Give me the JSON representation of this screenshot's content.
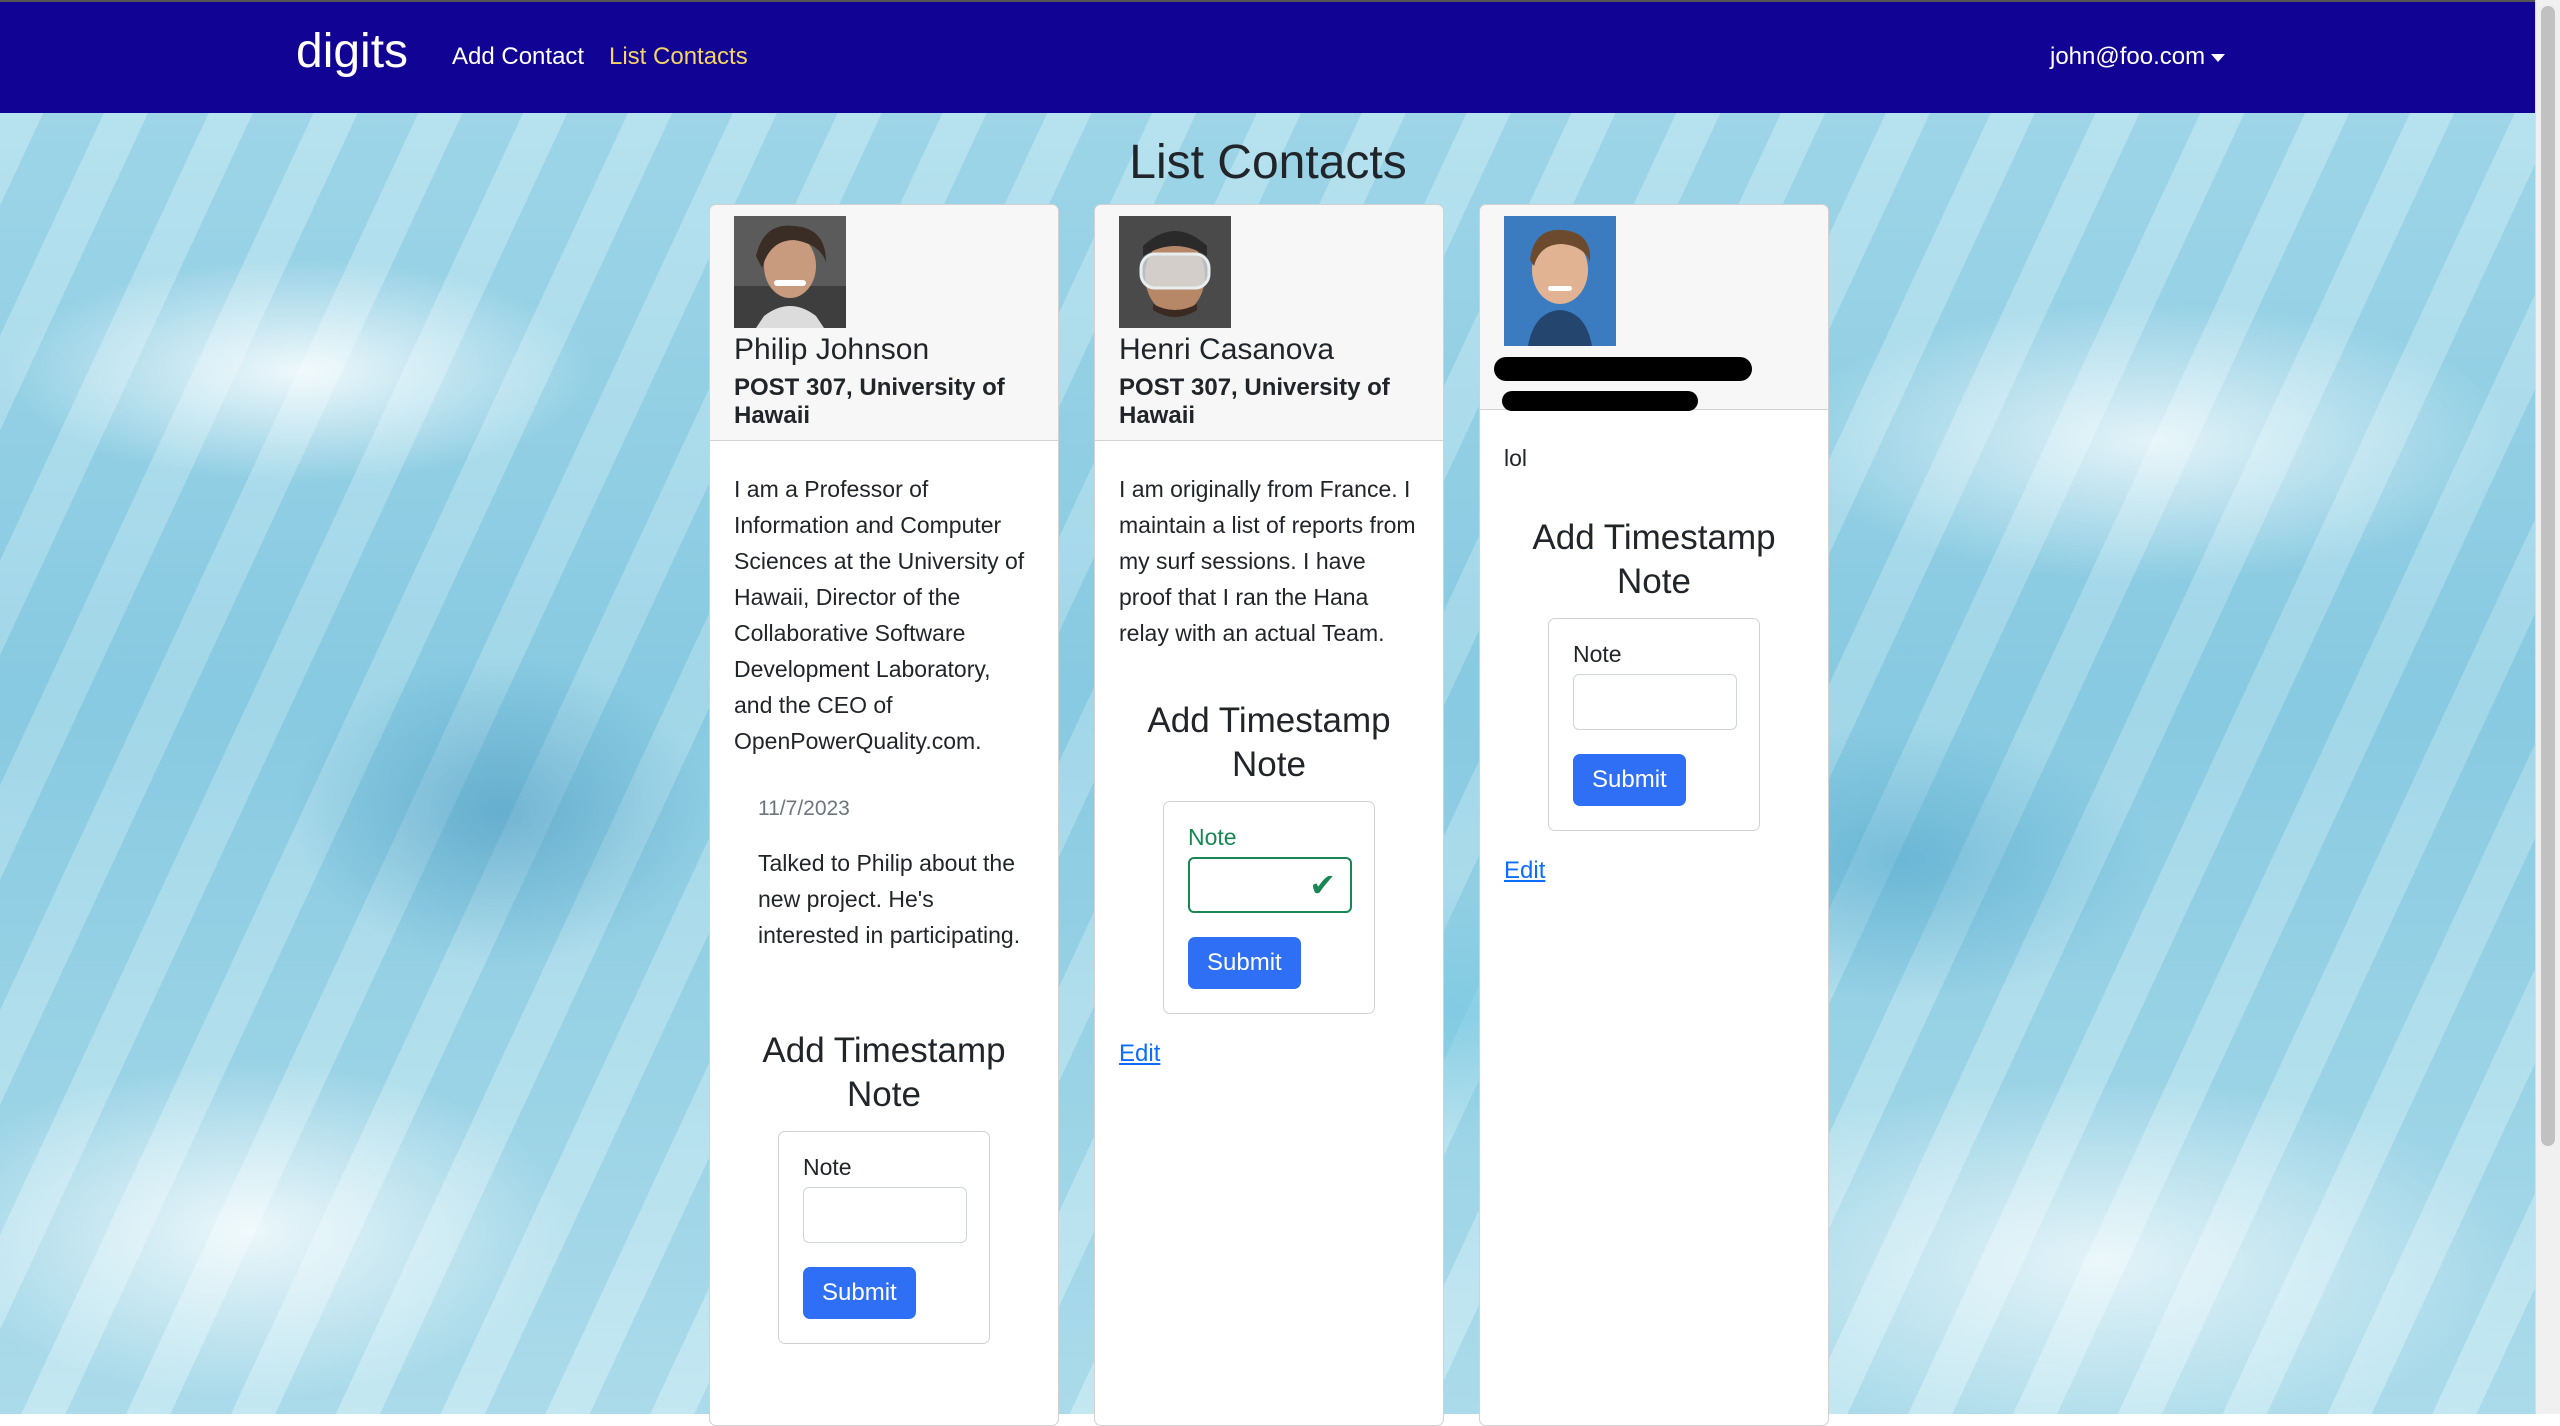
{
  "nav": {
    "brand": "digits",
    "links": [
      "Add Contact",
      "List Contacts"
    ],
    "user": "john@foo.com"
  },
  "page": {
    "title": "List Contacts"
  },
  "contacts": [
    {
      "name": "Philip Johnson",
      "address": "POST 307, University of Hawaii",
      "description": "I am a Professor of Information and Computer Sciences at the University of Hawaii, Director of the Collaborative Software Development Laboratory, and the CEO of OpenPowerQuality.com.",
      "notes": [
        {
          "date": "11/7/2023",
          "text": "Talked to Philip about the new project. He's interested in participating."
        }
      ]
    },
    {
      "name": "Henri Casanova",
      "address": "POST 307, University of Hawaii",
      "description": "I am originally from France. I maintain a list of reports from my surf sessions. I have proof that I ran the Hana relay with an actual Team.",
      "notes": []
    },
    {
      "name": "",
      "address": "",
      "description": "lol",
      "notes": []
    }
  ],
  "form": {
    "title": "Add Timestamp Note",
    "label": "Note",
    "submit": "Submit",
    "edit": "Edit"
  },
  "colors": {
    "navbar": "#110394",
    "active_link": "#f5d565",
    "button": "#2f6ff5",
    "valid": "#198754"
  }
}
